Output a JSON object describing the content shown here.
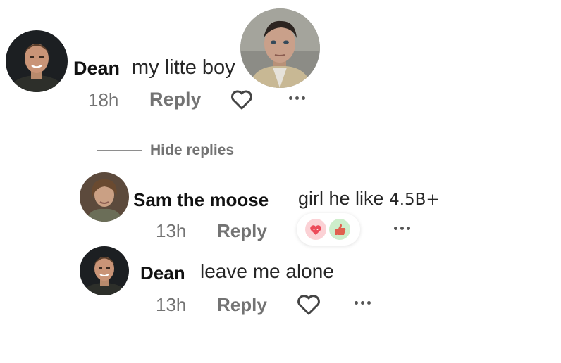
{
  "comments": [
    {
      "author": "Dean",
      "text": "my litte boy",
      "time": "18h",
      "reply_label": "Reply",
      "action_icon": "heart-outline-icon"
    }
  ],
  "thread": {
    "hide_replies_label": "Hide replies"
  },
  "replies": [
    {
      "author": "Sam the moose",
      "text": "girl he like",
      "text_suffix": "4.5B+",
      "time": "13h",
      "reply_label": "Reply",
      "reactions": [
        "heart-face-icon",
        "thumbs-up-icon"
      ]
    },
    {
      "author": "Dean",
      "text": "leave me alone",
      "time": "13h",
      "reply_label": "Reply",
      "action_icon": "heart-outline-icon"
    }
  ],
  "colors": {
    "meta_gray": "#737373",
    "reaction_red": "#ec4a5a",
    "reaction_green": "#a6e3a1"
  }
}
